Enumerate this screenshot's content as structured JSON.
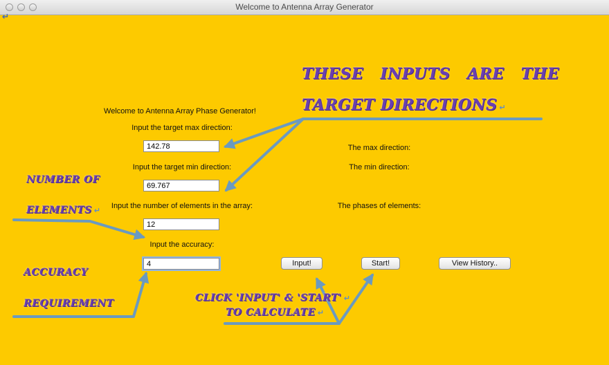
{
  "window": {
    "title": "Welcome to Antenna Array Generator"
  },
  "form": {
    "welcome": "Welcome to Antenna Array Phase Generator!",
    "max_label": "Input the target max direction:",
    "max_value": "142.78",
    "min_label": "Input the target min direction:",
    "min_value": "69.767",
    "elements_label": "Input the number of elements in the array:",
    "elements_value": "12",
    "accuracy_label": "Input the accuracy:",
    "accuracy_value": "4"
  },
  "results": {
    "max_direction": "The max direction:",
    "min_direction": "The min direction:",
    "phases": "The phases of elements:"
  },
  "buttons": {
    "input": "Input!",
    "start": "Start!",
    "history": "View History.."
  },
  "annotations": {
    "return_glyph": "↵",
    "targets_line1": "THESE  INPUTS  ARE  THE",
    "targets_line2": "TARGET DIRECTIONS",
    "number_of": "NUMBER  OF",
    "elements": "ELEMENTS",
    "accuracy": "ACCURACY",
    "requirement": "REQUIREMENT",
    "click_line1": "CLICK 'INPUT' & 'START'",
    "click_line2": "TO CALCULATE"
  },
  "colors": {
    "background": "#fdca00",
    "annotation_text": "#6a3fb0",
    "arrow": "#6a9ac0"
  }
}
